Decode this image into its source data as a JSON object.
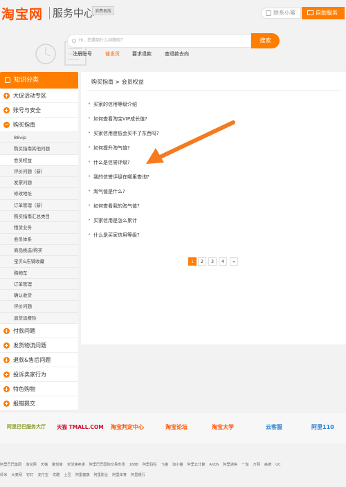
{
  "header": {
    "logo": "淘宝网",
    "subtitle": "服务中心",
    "badge": "消费者版",
    "contact_button": "联系小蜜",
    "self_service_button": "自助服务"
  },
  "search": {
    "placeholder": "Hi，您遇到什么问题啦？",
    "button": "搜索",
    "quick_links": [
      "注册账号",
      "催发货",
      "要求退款",
      "查退款去向"
    ]
  },
  "sidebar": {
    "title": "知识分类",
    "top_categories": [
      "大促活动专区",
      "账号与安全",
      "购买指南"
    ],
    "sub_items": [
      "88vip",
      "购买指南其他问题",
      "会员权益",
      "评价问题（新）",
      "发票问题",
      "修改地址",
      "订单管理（新）",
      "购买指南汇总类目",
      "租赁业务",
      "会员体系",
      "商品挑选/购买",
      "宝贝&店铺收藏",
      "购物车",
      "订单管理",
      "确认收货",
      "评价问题",
      "退货运费险"
    ],
    "active_sub": "会员权益",
    "bottom_categories": [
      "付款问题",
      "发货物流问题",
      "退款&售后问题",
      "投诉卖家行为",
      "特色购物",
      "报错提交"
    ]
  },
  "main": {
    "breadcrumb": "购买指南 > 会员权益",
    "questions": [
      "买家的信用等级介绍",
      "如何查看淘宝VIP成长值?",
      "买家信用度低会买不了东西吗?",
      "如何提升淘气值?",
      "什么是信誉评级?",
      "我的信誉评级在哪里查询?",
      "淘气值是什么?",
      "如何查看我的淘气值?",
      "买家信用是怎么累计",
      "什么是买家信用等级?"
    ],
    "pagination": [
      "1",
      "2",
      "3",
      "4",
      "»"
    ]
  },
  "partners": [
    "阿里巴巴服务大厅",
    "天猫 TMALL.COM",
    "淘宝判定中心",
    "淘宝论坛",
    "淘宝大学",
    "云客服",
    "阿里110"
  ],
  "footer": {
    "row1": [
      "阿里巴巴集团",
      "淘宝网",
      "天猫",
      "聚划算",
      "全球速卖通",
      "阿里巴巴国际交易市场",
      "1688",
      "阿里妈妈",
      "飞猪",
      "淘小铺",
      "阿里云计算",
      "AliOS",
      "阿里通信",
      "一淘",
      "万网",
      "高德",
      "UC"
    ],
    "row2": [
      "虾米",
      "大麦网",
      "钉钉",
      "支付宝",
      "优酷",
      "土豆",
      "阿里健康",
      "阿里影业",
      "阿里体育",
      "阿里银行"
    ]
  },
  "colors": {
    "accent": "#ff7e00",
    "brand": "#ff5000"
  }
}
